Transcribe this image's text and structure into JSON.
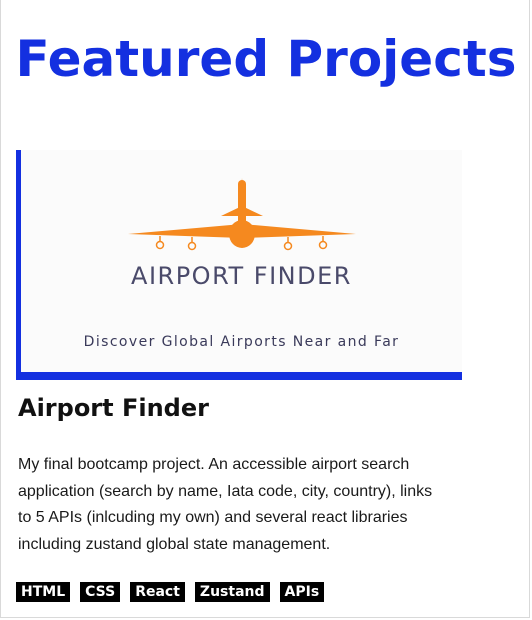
{
  "page": {
    "title": "Featured Projects"
  },
  "project": {
    "image": {
      "logo_title": "AIRPORT FINDER",
      "tagline": "Discover Global Airports Near and Far",
      "icon": "airplane-icon",
      "accent_color": "#f5891f"
    },
    "title": "Airport Finder",
    "description": "My final bootcamp project. An accessible airport search application (search by name, Iata code, city, country), links to 5 APIs (inlcuding my own) and several react libraries including zustand global state management.",
    "tags": [
      "HTML",
      "CSS",
      "React",
      "Zustand",
      "APIs"
    ]
  },
  "colors": {
    "brand": "#1430e0",
    "tag_bg": "#000000"
  }
}
